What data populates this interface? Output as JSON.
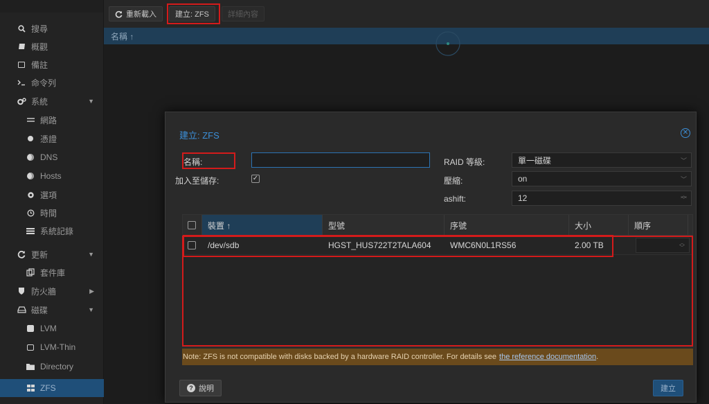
{
  "sidebar": {
    "items": [
      {
        "label": "搜尋",
        "icon": "search-icon"
      },
      {
        "label": "概觀",
        "icon": "book-icon"
      },
      {
        "label": "備註",
        "icon": "note-icon"
      },
      {
        "label": "命令列",
        "icon": "terminal-icon"
      },
      {
        "label": "系統",
        "icon": "gears-icon"
      },
      {
        "label": "網路",
        "icon": "exchange-icon"
      },
      {
        "label": "憑證",
        "icon": "certificate-icon"
      },
      {
        "label": "DNS",
        "icon": "globe-icon"
      },
      {
        "label": "Hosts",
        "icon": "globe-icon"
      },
      {
        "label": "選項",
        "icon": "gear-icon"
      },
      {
        "label": "時間",
        "icon": "clock-icon"
      },
      {
        "label": "系統記錄",
        "icon": "list-icon"
      },
      {
        "label": "更新",
        "icon": "refresh-icon"
      },
      {
        "label": "套件庫",
        "icon": "files-icon"
      },
      {
        "label": "防火牆",
        "icon": "shield-icon"
      },
      {
        "label": "磁碟",
        "icon": "hdd-icon"
      },
      {
        "label": "LVM",
        "icon": "square-icon"
      },
      {
        "label": "LVM-Thin",
        "icon": "square-outline-icon"
      },
      {
        "label": "Directory",
        "icon": "folder-icon"
      },
      {
        "label": "ZFS",
        "icon": "grid-icon"
      }
    ]
  },
  "toolbar": {
    "reload_label": "重新載入",
    "create_label": "建立: ZFS",
    "detail_label": "詳細內容"
  },
  "list": {
    "name_header": "名稱 ↑"
  },
  "dialog": {
    "title": "建立: ZFS",
    "name_label": "名稱:",
    "name_value": "",
    "add_storage_label": "加入至儲存:",
    "raid_label": "RAID 等級:",
    "raid_value": "單一磁碟",
    "compression_label": "壓縮:",
    "compression_value": "on",
    "ashift_label": "ashift:",
    "ashift_value": "12",
    "grid": {
      "columns": [
        "裝置 ↑",
        "型號",
        "序號",
        "大小",
        "順序"
      ],
      "rows": [
        {
          "device": "/dev/sdb",
          "model": "HGST_HUS722T2TALA604",
          "serial": "WMC6N0L1RS56",
          "size": "2.00 TB"
        }
      ]
    },
    "note_text": "Note: ZFS is not compatible with disks backed by a hardware RAID controller. For details see",
    "note_link": "the reference documentation",
    "note_end": ".",
    "help_label": "說明",
    "create_label": "建立"
  },
  "colors": {
    "accent": "#3c8fd8",
    "active_nav": "#1f4f79",
    "note_bg": "#6a4a1c",
    "highlight_box": "#d41b1b"
  }
}
